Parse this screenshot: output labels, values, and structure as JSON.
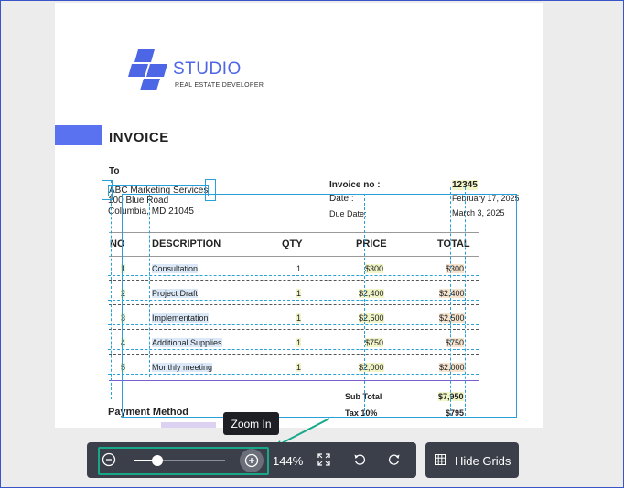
{
  "document": {
    "brand": "STUDIO",
    "tagline": "REAL ESTATE DEVELOPER",
    "title": "INVOICE",
    "to_label": "To",
    "to_lines": [
      "ABC Marketing Services",
      "100 Blue Road",
      "Columbia, MD 21045"
    ],
    "invoice_no_label": "Invoice no :",
    "invoice_no_value": "12345",
    "date_label": "Date :",
    "date_value": "February 17, 2025",
    "due_label": "Due Date:",
    "due_value": "March 3, 2025",
    "headers": {
      "no": "NO",
      "description": "DESCRIPTION",
      "qty": "QTY",
      "price": "PRICE",
      "total": "TOTAL"
    },
    "rows": [
      {
        "no": "1",
        "description": "Consultation",
        "qty": "1",
        "price": "$300",
        "total": "$300"
      },
      {
        "no": "2",
        "description": "Project Draft",
        "qty": "1",
        "price": "$2,400",
        "total": "$2,400"
      },
      {
        "no": "3",
        "description": "Implementation",
        "qty": "1",
        "price": "$2,500",
        "total": "$2,500"
      },
      {
        "no": "4",
        "description": "Additional Supplies",
        "qty": "1",
        "price": "$750",
        "total": "$750"
      },
      {
        "no": "5",
        "description": "Monthly meeting",
        "qty": "1",
        "price": "$2,000",
        "total": "$2,000"
      }
    ],
    "subtotal_label": "Sub Total",
    "subtotal_value": "$7,950",
    "tax_label": "Tax 10%",
    "tax_value": "$795",
    "payment_method": "Payment Method"
  },
  "tooltip": "Zoom In",
  "toolbar": {
    "zoom_percent": "144%",
    "zoom_level": 0.26,
    "hide_grids_label": "Hide Grids",
    "icons": [
      "zoom-out-icon",
      "zoom-in-icon",
      "fit-screen-icon",
      "rotate-left-icon",
      "rotate-right-icon",
      "grid-icon"
    ]
  },
  "colors": {
    "accent": "#17a88a",
    "brand": "#5a72ef",
    "toolbar": "#3b3f4a",
    "guide": "#2aa0d8"
  }
}
